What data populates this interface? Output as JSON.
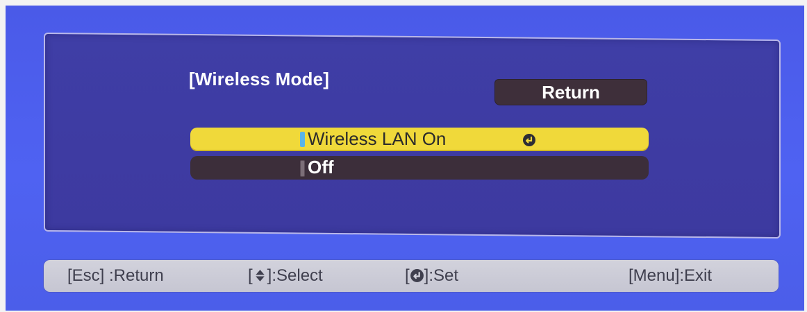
{
  "dialog": {
    "title": "[Wireless Mode]",
    "return_label": "Return",
    "options": [
      {
        "label": "Wireless LAN On",
        "selected": true,
        "icon": "enter-icon"
      },
      {
        "label": "Off",
        "selected": false
      }
    ]
  },
  "footer": {
    "esc_key": "[Esc]",
    "esc_action": ":Return",
    "select_open": "[",
    "select_icon": "up-down-arrow-icon",
    "select_close": "]:Select",
    "set_open": "[",
    "set_icon": "enter-icon",
    "set_close": "]:Set",
    "exit_label": "[Menu]:Exit"
  },
  "colors": {
    "background": "#4f62f2",
    "panel": "#3e3ba2",
    "highlight": "#f0d93a",
    "row_dark": "#3c2e3a",
    "footer": "#d2d2dc"
  }
}
